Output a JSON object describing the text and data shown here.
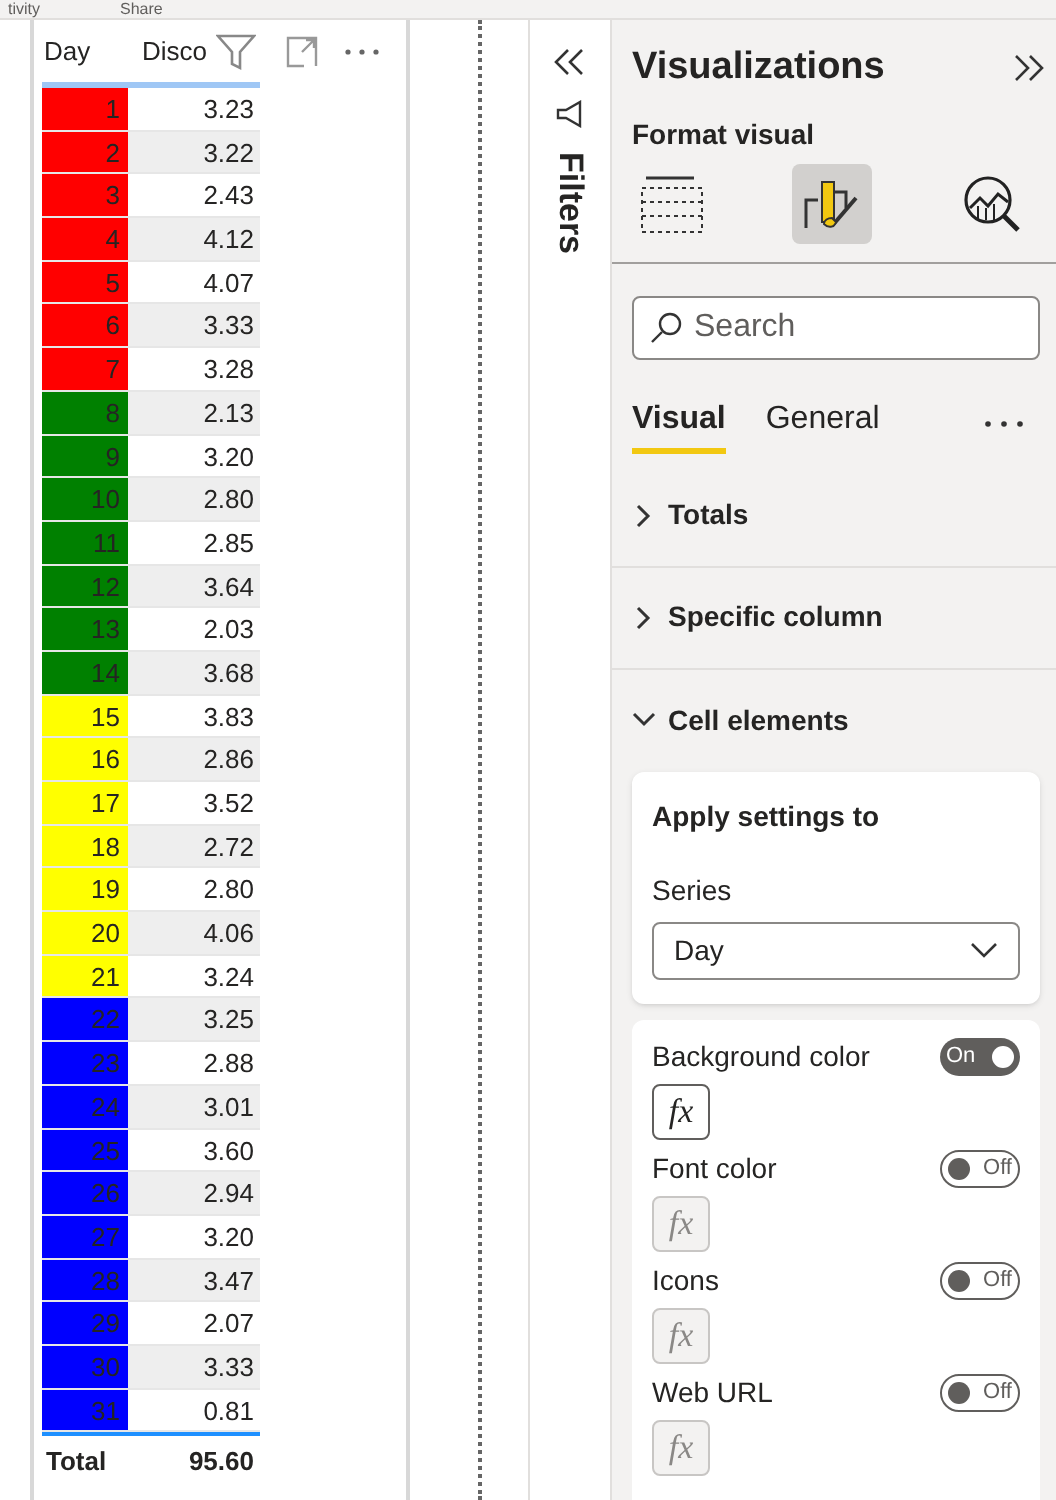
{
  "top_tabs": [
    "tivity",
    "Share"
  ],
  "table": {
    "columns": [
      "Day",
      "Disco"
    ],
    "rows": [
      {
        "day": "1",
        "value": "3.23",
        "color": "#ff0000"
      },
      {
        "day": "2",
        "value": "3.22",
        "color": "#ff0000"
      },
      {
        "day": "3",
        "value": "2.43",
        "color": "#ff0000"
      },
      {
        "day": "4",
        "value": "4.12",
        "color": "#ff0000"
      },
      {
        "day": "5",
        "value": "4.07",
        "color": "#ff0000"
      },
      {
        "day": "6",
        "value": "3.33",
        "color": "#ff0000"
      },
      {
        "day": "7",
        "value": "3.28",
        "color": "#ff0000"
      },
      {
        "day": "8",
        "value": "2.13",
        "color": "#008000"
      },
      {
        "day": "9",
        "value": "3.20",
        "color": "#008000"
      },
      {
        "day": "10",
        "value": "2.80",
        "color": "#008000"
      },
      {
        "day": "11",
        "value": "2.85",
        "color": "#008000"
      },
      {
        "day": "12",
        "value": "3.64",
        "color": "#008000"
      },
      {
        "day": "13",
        "value": "2.03",
        "color": "#008000"
      },
      {
        "day": "14",
        "value": "3.68",
        "color": "#008000"
      },
      {
        "day": "15",
        "value": "3.83",
        "color": "#ffff00"
      },
      {
        "day": "16",
        "value": "2.86",
        "color": "#ffff00"
      },
      {
        "day": "17",
        "value": "3.52",
        "color": "#ffff00"
      },
      {
        "day": "18",
        "value": "2.72",
        "color": "#ffff00"
      },
      {
        "day": "19",
        "value": "2.80",
        "color": "#ffff00"
      },
      {
        "day": "20",
        "value": "4.06",
        "color": "#ffff00"
      },
      {
        "day": "21",
        "value": "3.24",
        "color": "#ffff00"
      },
      {
        "day": "22",
        "value": "3.25",
        "color": "#0000ff"
      },
      {
        "day": "23",
        "value": "2.88",
        "color": "#0000ff"
      },
      {
        "day": "24",
        "value": "3.01",
        "color": "#0000ff"
      },
      {
        "day": "25",
        "value": "3.60",
        "color": "#0000ff"
      },
      {
        "day": "26",
        "value": "2.94",
        "color": "#0000ff"
      },
      {
        "day": "27",
        "value": "3.20",
        "color": "#0000ff"
      },
      {
        "day": "28",
        "value": "3.47",
        "color": "#0000ff"
      },
      {
        "day": "29",
        "value": "2.07",
        "color": "#0000ff"
      },
      {
        "day": "30",
        "value": "3.33",
        "color": "#0000ff"
      },
      {
        "day": "31",
        "value": "0.81",
        "color": "#0000ff"
      }
    ],
    "total": {
      "label": "Total",
      "value": "95.60"
    }
  },
  "filters_pane": {
    "title": "Filters"
  },
  "visualizations": {
    "title": "Visualizations",
    "subtitle": "Format visual",
    "pane_tabs": [
      {
        "kind": "build",
        "selected": false
      },
      {
        "kind": "format",
        "selected": true
      },
      {
        "kind": "analytics",
        "selected": false
      }
    ],
    "search": {
      "placeholder": "Search"
    },
    "tabs": [
      {
        "label": "Visual",
        "selected": true
      },
      {
        "label": "General",
        "selected": false
      }
    ],
    "sections": [
      {
        "label": "Totals",
        "expanded": false
      },
      {
        "label": "Specific column",
        "expanded": false
      },
      {
        "label": "Cell elements",
        "expanded": true
      }
    ],
    "apply_card": {
      "title": "Apply settings to",
      "field_label": "Series",
      "value": "Day"
    },
    "settings": [
      {
        "label": "Background color",
        "on": true,
        "toggle_text": "On",
        "fx": "fx"
      },
      {
        "label": "Font color",
        "on": false,
        "toggle_text": "Off",
        "fx": "fx"
      },
      {
        "label": "Icons",
        "on": false,
        "toggle_text": "Off",
        "fx": "fx"
      },
      {
        "label": "Web URL",
        "on": false,
        "toggle_text": "Off",
        "fx": "fx"
      }
    ]
  }
}
